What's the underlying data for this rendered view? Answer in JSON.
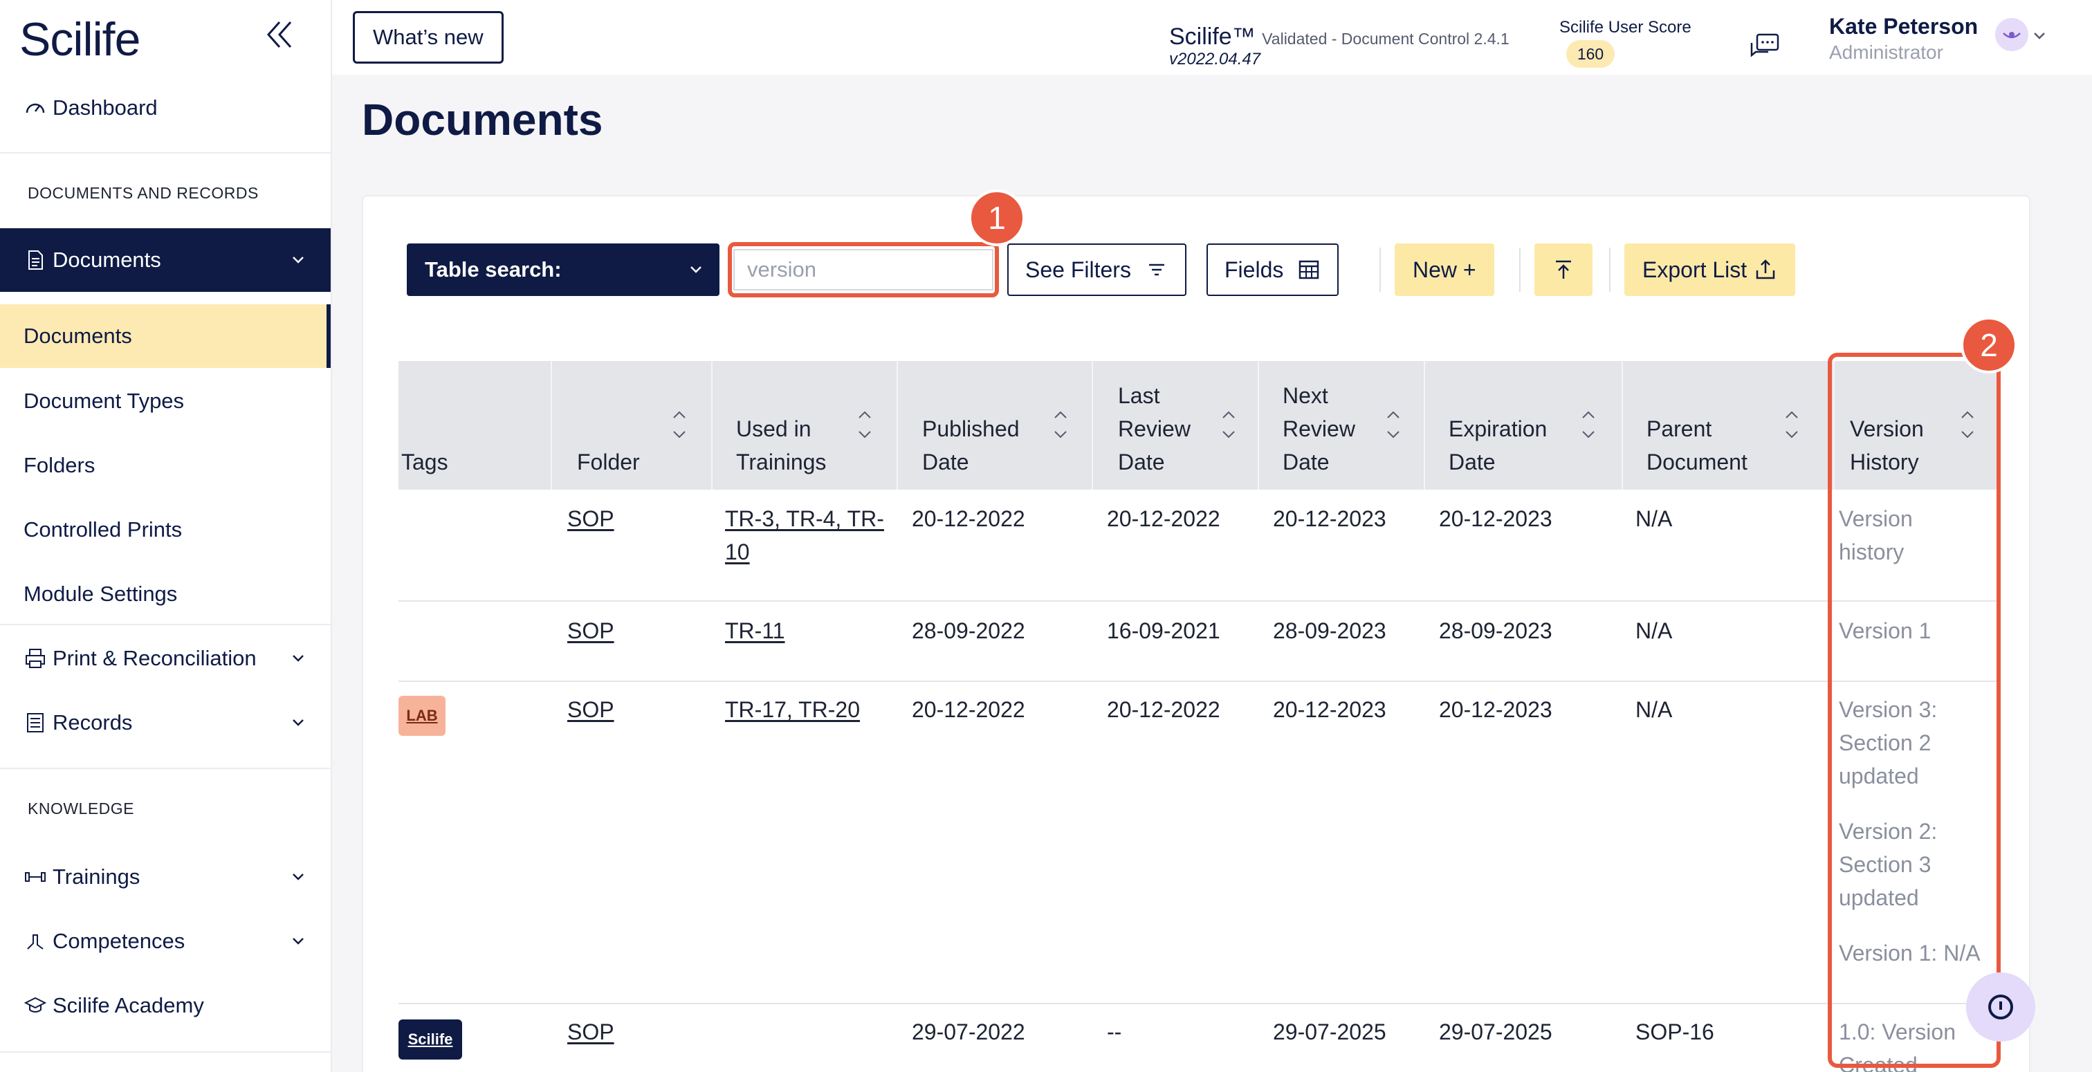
{
  "sidebar": {
    "logo": "Scilife",
    "dashboard": "Dashboard",
    "section_docs": "DOCUMENTS AND RECORDS",
    "documents_group": "Documents",
    "sub_items": [
      "Documents",
      "Document Types",
      "Folders",
      "Controlled Prints",
      "Module Settings"
    ],
    "print_reconciliation": "Print & Reconciliation",
    "records": "Records",
    "section_knowledge": "KNOWLEDGE",
    "trainings": "Trainings",
    "competences": "Competences",
    "academy": "Scilife Academy"
  },
  "topbar": {
    "whats_new": "What’s new",
    "product": "Scilife™",
    "product_sub": "Validated - Document Control 2.4.1",
    "version": "v2022.04.47",
    "score_label": "Scilife User Score",
    "score": "160",
    "user_name": "Kate Peterson",
    "user_role": "Administrator"
  },
  "page": {
    "title": "Documents"
  },
  "toolbar": {
    "table_search": "Table search:",
    "search_value": "version",
    "see_filters": "See Filters",
    "fields": "Fields",
    "new": "New +",
    "export": "Export List"
  },
  "table": {
    "headers": {
      "tags": "Tags",
      "folder": "Folder",
      "used_1": "Used in",
      "used_2": "Trainings",
      "pub_1": "Published",
      "pub_2": "Date",
      "last_1": "Last",
      "last_2": "Review",
      "last_3": "Date",
      "next_1": "Next",
      "next_2": "Review",
      "next_3": "Date",
      "exp_1": "Expiration",
      "exp_2": "Date",
      "parent_1": "Parent",
      "parent_2": "Document",
      "ver_1": "Version",
      "ver_2": "History"
    },
    "rows": [
      {
        "folder": "SOP",
        "trainings": "TR-3, TR-4, TR-",
        "trainings_2": "10",
        "published": "20-12-2022",
        "last_review": "20-12-2022",
        "next_review": "20-12-2023",
        "expiration": "20-12-2023",
        "parent": "N/A",
        "history": [
          "Version",
          "history"
        ]
      },
      {
        "folder": "SOP",
        "trainings": "TR-11",
        "published": "28-09-2022",
        "last_review": "16-09-2021",
        "next_review": "28-09-2023",
        "expiration": "28-09-2023",
        "parent": "N/A",
        "history": [
          "Version 1"
        ]
      },
      {
        "tag": "LAB",
        "folder": "SOP",
        "trainings": "TR-17, TR-20",
        "published": "20-12-2022",
        "last_review": "20-12-2022",
        "next_review": "20-12-2023",
        "expiration": "20-12-2023",
        "parent": "N/A",
        "history": [
          "Version 3:",
          "Section 2",
          "updated",
          "Version 2:",
          "Section 3",
          "updated",
          "Version 1: N/A"
        ]
      },
      {
        "tag": "Scilife",
        "folder": "SOP",
        "trainings": "",
        "published": "29-07-2022",
        "last_review": "--",
        "next_review": "29-07-2025",
        "expiration": "29-07-2025",
        "parent": "SOP-16",
        "history": [
          "1.0: Version",
          "Created"
        ]
      }
    ]
  },
  "annotations": {
    "marker_1": "1",
    "marker_2": "2"
  },
  "colors": {
    "navy": "#0f1b45",
    "highlight": "#e9593f",
    "yellow": "#fde9a6"
  }
}
